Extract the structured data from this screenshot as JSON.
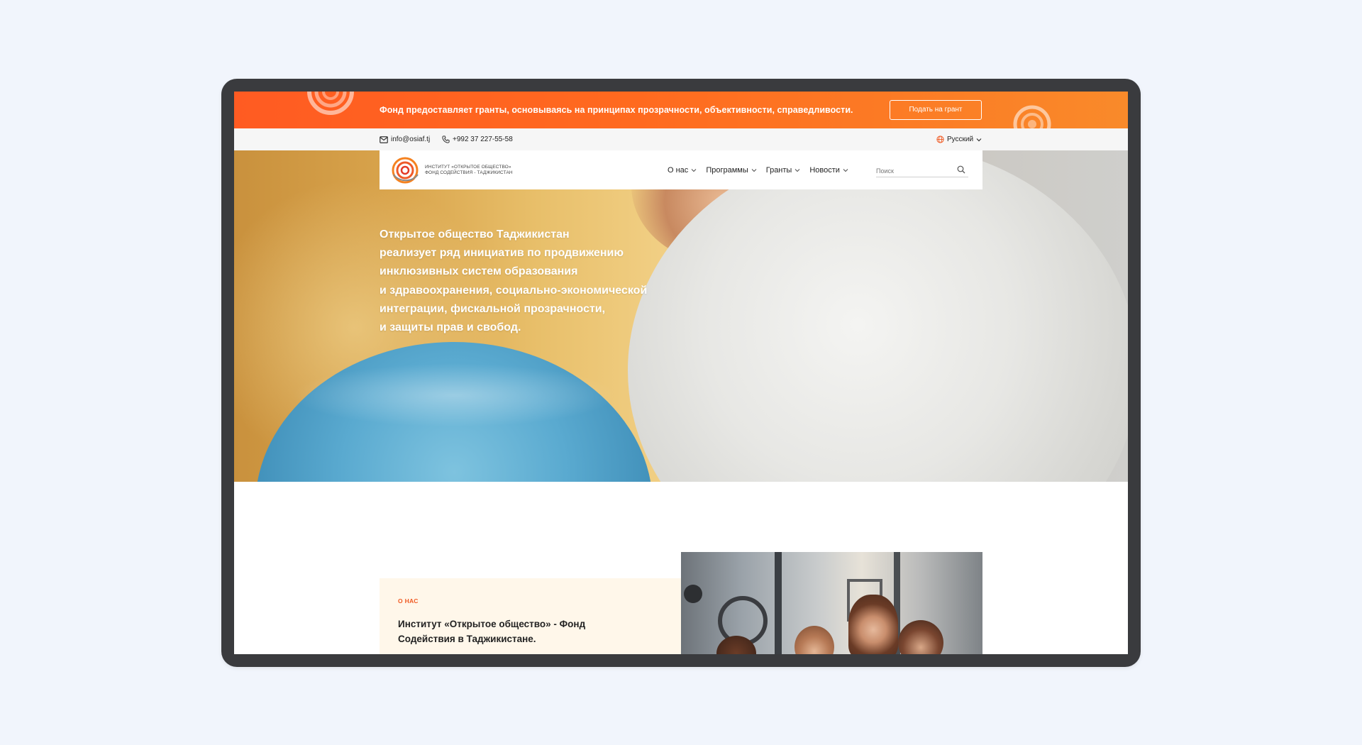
{
  "promo": {
    "text": "Фонд предоставляет гранты, основываясь на принципах прозрачности, объективности, справедливости.",
    "button": "Подать на грант"
  },
  "contact": {
    "email": "info@osiaf.tj",
    "phone": "+992 37 227-55-58",
    "language": "Русский"
  },
  "nav": {
    "logo_line1": "Институт «Открытое общество»",
    "logo_line2": "Фонд содействия - Таджикистан",
    "menu": [
      {
        "label": "О нас"
      },
      {
        "label": "Программы"
      },
      {
        "label": "Гранты"
      },
      {
        "label": "Новости"
      }
    ],
    "search_placeholder": "Поиск"
  },
  "hero": {
    "lines": [
      "Открытое общество Таджикистан",
      "реализует ряд инициатив по продвижению",
      "инклюзивных систем образования",
      "и здравоохранения, социально-экономической",
      "интеграции, фискальной прозрачности,",
      "и защиты прав и свобод."
    ]
  },
  "about": {
    "label": "О НАС",
    "title": "Институт «Открытое общество» - Фонд Содействия в Таджикистане."
  },
  "colors": {
    "accent": "#f05a23",
    "promo_start": "#ff5b22",
    "promo_end": "#f98a2a",
    "page_bg": "#f1f5fc",
    "frame": "#3a3b3e"
  },
  "icons": [
    "mail-icon",
    "phone-icon",
    "globe-icon",
    "chevron-down-icon",
    "search-icon",
    "swirl-logo-icon"
  ]
}
